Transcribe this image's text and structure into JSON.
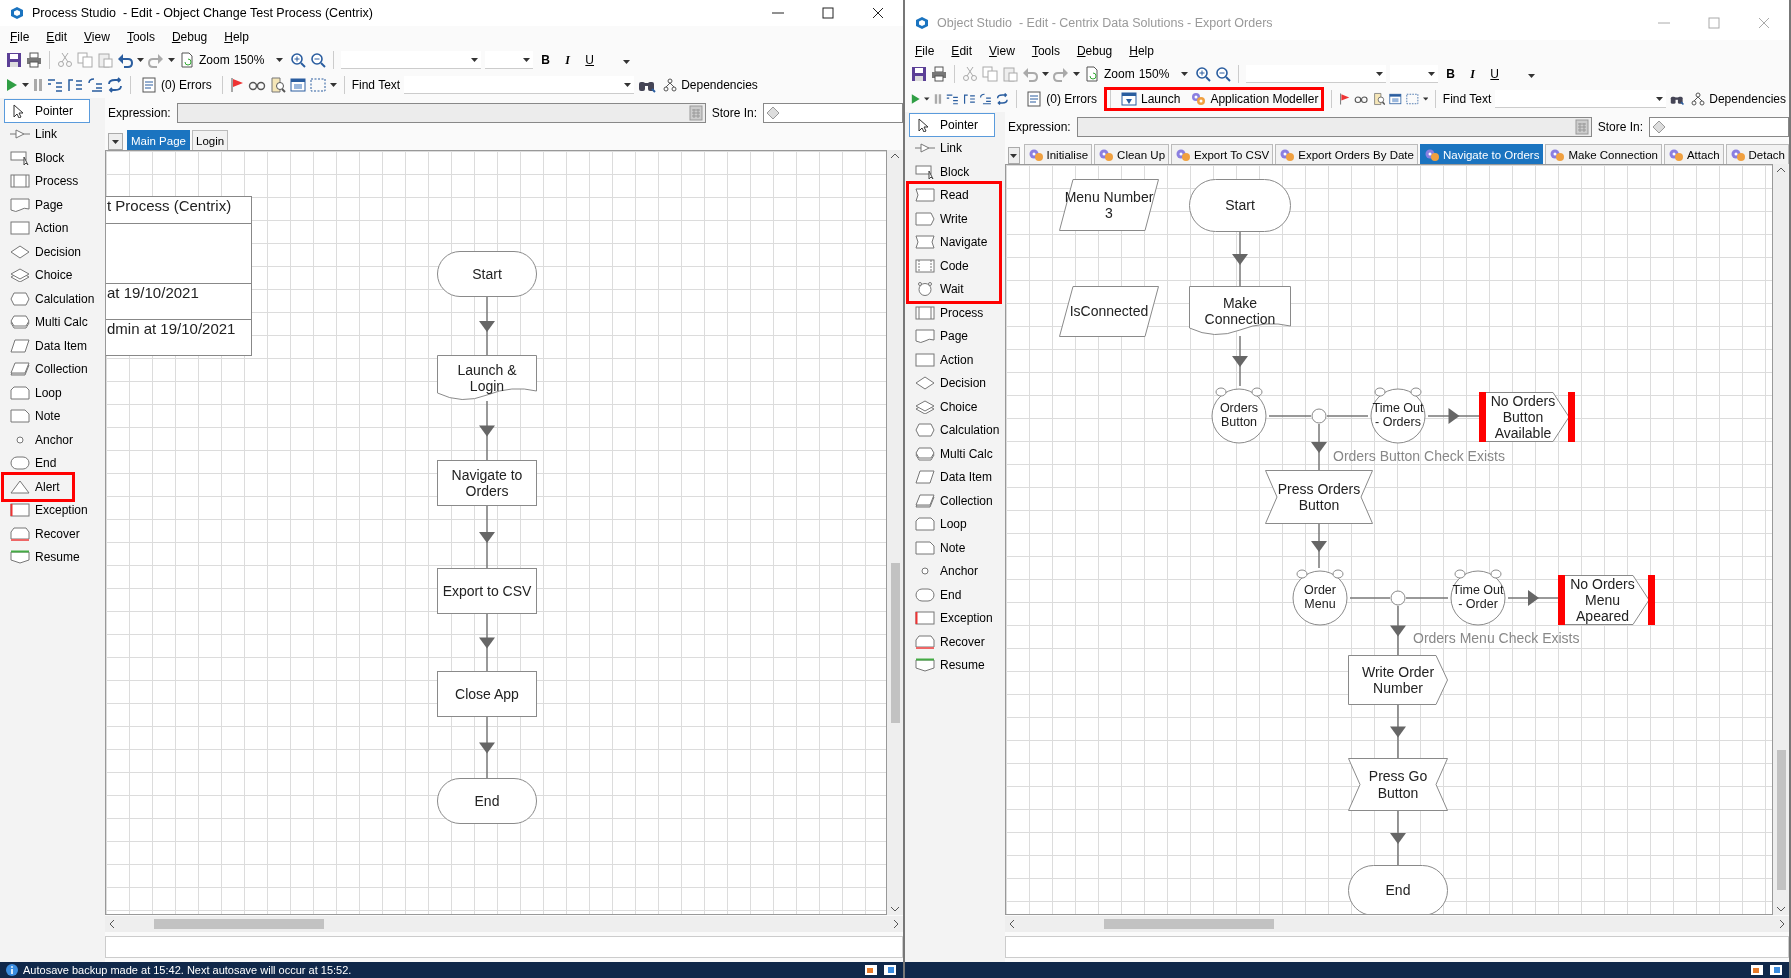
{
  "windows": [
    {
      "title": "Process Studio  - Edit - Object Change Test Process (Centrix)",
      "active": true,
      "menu": [
        "File",
        "Edit",
        "View",
        "Tools",
        "Debug",
        "Help"
      ],
      "toolbar": {
        "zoom_label": "Zoom",
        "zoom_value": "150%",
        "format_buttons": [
          "B",
          "I",
          "U"
        ],
        "undo_enabled": true,
        "errors": "(0) Errors",
        "find_label": "Find Text",
        "dependencies": "Dependencies"
      },
      "expression_label": "Expression:",
      "store_in_label": "Store In:",
      "palette": [
        {
          "highlighted": false,
          "items": [
            {
              "kind": "pointer",
              "label": "Pointer",
              "selected": true
            },
            {
              "kind": "link",
              "label": "Link",
              "selected": false
            },
            {
              "kind": "block",
              "label": "Block",
              "selected": false
            },
            {
              "kind": "process",
              "label": "Process",
              "selected": false
            },
            {
              "kind": "page",
              "label": "Page",
              "selected": false
            },
            {
              "kind": "action",
              "label": "Action",
              "selected": false
            },
            {
              "kind": "decision",
              "label": "Decision",
              "selected": false
            },
            {
              "kind": "choice",
              "label": "Choice",
              "selected": false
            },
            {
              "kind": "calculation",
              "label": "Calculation",
              "selected": false
            },
            {
              "kind": "multi_calc",
              "label": "Multi Calc",
              "selected": false
            },
            {
              "kind": "data_item",
              "label": "Data Item",
              "selected": false
            },
            {
              "kind": "collection",
              "label": "Collection",
              "selected": false
            },
            {
              "kind": "loop",
              "label": "Loop",
              "selected": false
            },
            {
              "kind": "note",
              "label": "Note",
              "selected": false
            },
            {
              "kind": "anchor",
              "label": "Anchor",
              "selected": false
            },
            {
              "kind": "end",
              "label": "End",
              "selected": false
            }
          ]
        },
        {
          "highlighted": true,
          "items": [
            {
              "kind": "alert",
              "label": "Alert",
              "selected": false
            }
          ]
        },
        {
          "highlighted": false,
          "items": [
            {
              "kind": "exception",
              "label": "Exception",
              "selected": false
            },
            {
              "kind": "recover",
              "label": "Recover",
              "selected": false
            },
            {
              "kind": "resume",
              "label": "Resume",
              "selected": false
            }
          ]
        }
      ],
      "tabs": [
        {
          "label": "Main Page",
          "selected": true,
          "kind": "plain"
        },
        {
          "label": "Login",
          "selected": false,
          "kind": "plain"
        }
      ],
      "canvas": {
        "info_box": [
          "t Process (Centrix)",
          "at 19/10/2021",
          "dmin at 19/10/2021"
        ],
        "nodes": [
          {
            "kind": "start",
            "label": "Start"
          },
          {
            "kind": "page",
            "label": "Launch & Login"
          },
          {
            "kind": "action",
            "label": "Navigate to Orders"
          },
          {
            "kind": "action",
            "label": "Export to CSV"
          },
          {
            "kind": "action",
            "label": "Close App"
          },
          {
            "kind": "end",
            "label": "End"
          }
        ]
      },
      "status_text": "Autosave backup made at 15:42. Next autosave will occur at 15:52."
    },
    {
      "title": "Object Studio  - Edit - Centrix Data Solutions - Export Orders",
      "active": false,
      "menu": [
        "File",
        "Edit",
        "View",
        "Tools",
        "Debug",
        "Help"
      ],
      "toolbar": {
        "zoom_label": "Zoom",
        "zoom_value": "150%",
        "format_buttons": [
          "B",
          "I",
          "U"
        ],
        "undo_enabled": false,
        "errors": "(0) Errors",
        "launch_group": {
          "highlighted": true,
          "buttons": [
            "Launch",
            "Application Modeller"
          ]
        },
        "find_label": "Find Text",
        "dependencies": "Dependencies"
      },
      "expression_label": "Expression:",
      "store_in_label": "Store In:",
      "palette": [
        {
          "highlighted": false,
          "items": [
            {
              "kind": "pointer",
              "label": "Pointer",
              "selected": true
            },
            {
              "kind": "link",
              "label": "Link",
              "selected": false
            },
            {
              "kind": "block",
              "label": "Block",
              "selected": false
            }
          ]
        },
        {
          "highlighted": true,
          "items": [
            {
              "kind": "read",
              "label": "Read",
              "selected": false
            },
            {
              "kind": "write",
              "label": "Write",
              "selected": false
            },
            {
              "kind": "navigate",
              "label": "Navigate",
              "selected": false
            },
            {
              "kind": "code",
              "label": "Code",
              "selected": false
            },
            {
              "kind": "wait",
              "label": "Wait",
              "selected": false
            }
          ]
        },
        {
          "highlighted": false,
          "items": [
            {
              "kind": "process",
              "label": "Process",
              "selected": false
            },
            {
              "kind": "page",
              "label": "Page",
              "selected": false
            },
            {
              "kind": "action",
              "label": "Action",
              "selected": false
            },
            {
              "kind": "decision",
              "label": "Decision",
              "selected": false
            },
            {
              "kind": "choice",
              "label": "Choice",
              "selected": false
            },
            {
              "kind": "calculation",
              "label": "Calculation",
              "selected": false
            },
            {
              "kind": "multi_calc",
              "label": "Multi Calc",
              "selected": false
            },
            {
              "kind": "data_item",
              "label": "Data Item",
              "selected": false
            },
            {
              "kind": "collection",
              "label": "Collection",
              "selected": false
            },
            {
              "kind": "loop",
              "label": "Loop",
              "selected": false
            },
            {
              "kind": "note",
              "label": "Note",
              "selected": false
            },
            {
              "kind": "anchor",
              "label": "Anchor",
              "selected": false
            },
            {
              "kind": "end",
              "label": "End",
              "selected": false
            },
            {
              "kind": "exception",
              "label": "Exception",
              "selected": false
            },
            {
              "kind": "recover",
              "label": "Recover",
              "selected": false
            },
            {
              "kind": "resume",
              "label": "Resume",
              "selected": false
            }
          ]
        }
      ],
      "tabs": [
        {
          "label": "Initialise",
          "selected": false,
          "kind": "action"
        },
        {
          "label": "Clean Up",
          "selected": false,
          "kind": "action"
        },
        {
          "label": "Export To CSV",
          "selected": false,
          "kind": "action"
        },
        {
          "label": "Export Orders By Date",
          "selected": false,
          "kind": "action"
        },
        {
          "label": "Navigate to Orders",
          "selected": true,
          "kind": "action"
        },
        {
          "label": "Make Connection",
          "selected": false,
          "kind": "action"
        },
        {
          "label": "Attach",
          "selected": false,
          "kind": "action"
        },
        {
          "label": "Detach",
          "selected": false,
          "kind": "action"
        }
      ],
      "canvas": {
        "nodes": [
          {
            "kind": "data",
            "label": "Menu Number 3"
          },
          {
            "kind": "data",
            "label": "IsConnected"
          },
          {
            "kind": "start",
            "label": "Start"
          },
          {
            "kind": "page",
            "label": "Make Connection"
          },
          {
            "kind": "wait",
            "label": "Orders Button"
          },
          {
            "kind": "anchor"
          },
          {
            "kind": "wait",
            "label": "Time Out - Orders"
          },
          {
            "kind": "exception",
            "label": "No Orders Button Available"
          },
          {
            "kind": "navigate",
            "label": "Press Orders Button"
          },
          {
            "kind": "wait",
            "label": "Order Menu"
          },
          {
            "kind": "anchor"
          },
          {
            "kind": "wait",
            "label": "Time Out - Order"
          },
          {
            "kind": "exception",
            "label": "No Orders Menu Apeared"
          },
          {
            "kind": "write",
            "label": "Write Order Number"
          },
          {
            "kind": "navigate",
            "label": "Press Go Button"
          },
          {
            "kind": "end",
            "label": "End"
          }
        ],
        "link_labels": [
          "Orders Button Check Exists",
          "Orders Menu Check Exists"
        ]
      }
    }
  ]
}
